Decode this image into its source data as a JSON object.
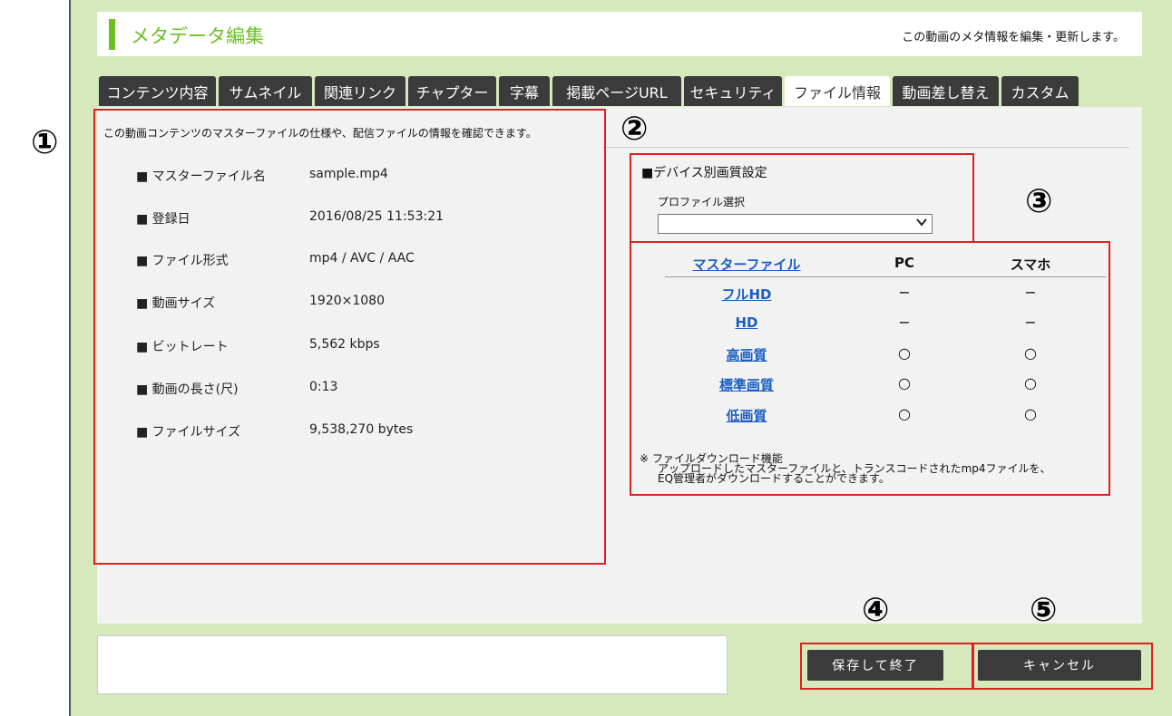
{
  "header": {
    "title": "メタデータ編集",
    "description": "この動画のメタ情報を編集・更新します。"
  },
  "tabs": [
    {
      "label": "コンテンツ内容",
      "active": false
    },
    {
      "label": "サムネイル",
      "active": false
    },
    {
      "label": "関連リンク",
      "active": false
    },
    {
      "label": "チャプター",
      "active": false
    },
    {
      "label": "字幕",
      "active": false
    },
    {
      "label": "掲載ページURL",
      "active": false
    },
    {
      "label": "セキュリティ",
      "active": false
    },
    {
      "label": "ファイル情報",
      "active": true
    },
    {
      "label": "動画差し替え",
      "active": false
    },
    {
      "label": "カスタム",
      "active": false
    }
  ],
  "file_info": {
    "intro": "この動画コンテンツのマスターファイルの仕様や、配信ファイルの情報を確認できます。",
    "rows": [
      {
        "key": "■ マスターファイル名",
        "value": "sample.mp4"
      },
      {
        "key": "■ 登録日",
        "value": "2016/08/25 11:53:21"
      },
      {
        "key": "■ ファイル形式",
        "value": "mp4 / AVC / AAC"
      },
      {
        "key": "■ 動画サイズ",
        "value": "1920×1080"
      },
      {
        "key": "■ ビットレート",
        "value": "5,562 kbps"
      },
      {
        "key": "■ 動画の長さ(尺)",
        "value": "0:13"
      },
      {
        "key": "■ ファイルサイズ",
        "value": "9,538,270 bytes"
      }
    ]
  },
  "device_quality": {
    "title": "■デバイス別画質設定",
    "profile_label": "プロファイル選択",
    "profile_value": ""
  },
  "quality_table": {
    "headers": [
      "マスターファイル",
      "PC",
      "スマホ"
    ],
    "rows": [
      {
        "name": "フルHD",
        "pc": "−",
        "sp": "−"
      },
      {
        "name": "HD",
        "pc": "−",
        "sp": "−"
      },
      {
        "name": "高画質",
        "pc": "○",
        "sp": "○"
      },
      {
        "name": "標準画質",
        "pc": "○",
        "sp": "○"
      },
      {
        "name": "低画質",
        "pc": "○",
        "sp": "○"
      }
    ],
    "note_line1": "※  ファイルダウンロード機能",
    "note_line2": "アップロードしたマスターファイルと、トランスコードされたmp4ファイルを、",
    "note_line3": "EQ管理者がダウンロードすることができます。"
  },
  "buttons": {
    "save": "保存して終了",
    "cancel": "キャンセル"
  },
  "callouts": [
    "①",
    "②",
    "③",
    "④",
    "⑤"
  ],
  "colors": {
    "accent_green": "#6cbf22",
    "frame_bg": "#d5e9bd",
    "tab_dark": "#3b3b3b",
    "link_blue": "#1a5ec4",
    "callout_red": "#e02020"
  }
}
